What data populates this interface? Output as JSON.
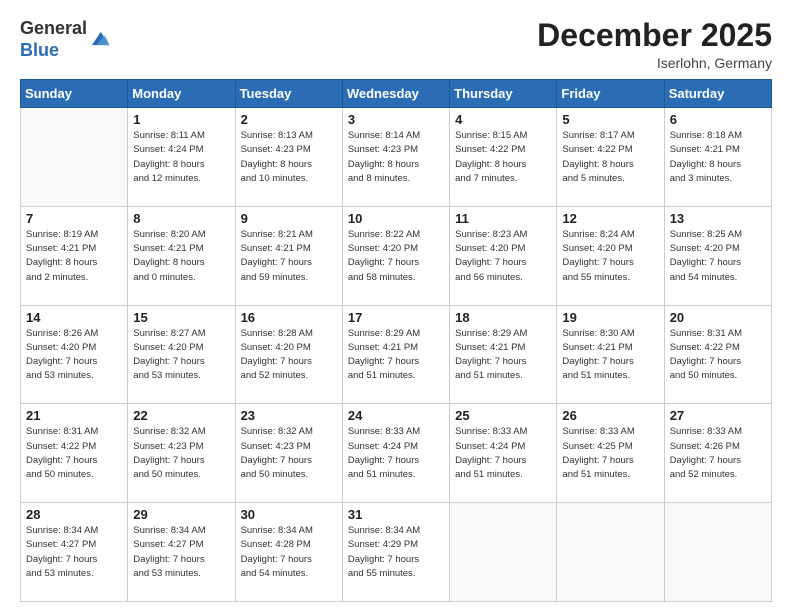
{
  "logo": {
    "line1": "General",
    "line2": "Blue"
  },
  "title": "December 2025",
  "subtitle": "Iserlohn, Germany",
  "days_header": [
    "Sunday",
    "Monday",
    "Tuesday",
    "Wednesday",
    "Thursday",
    "Friday",
    "Saturday"
  ],
  "weeks": [
    [
      {
        "day": "",
        "info": ""
      },
      {
        "day": "1",
        "info": "Sunrise: 8:11 AM\nSunset: 4:24 PM\nDaylight: 8 hours\nand 12 minutes."
      },
      {
        "day": "2",
        "info": "Sunrise: 8:13 AM\nSunset: 4:23 PM\nDaylight: 8 hours\nand 10 minutes."
      },
      {
        "day": "3",
        "info": "Sunrise: 8:14 AM\nSunset: 4:23 PM\nDaylight: 8 hours\nand 8 minutes."
      },
      {
        "day": "4",
        "info": "Sunrise: 8:15 AM\nSunset: 4:22 PM\nDaylight: 8 hours\nand 7 minutes."
      },
      {
        "day": "5",
        "info": "Sunrise: 8:17 AM\nSunset: 4:22 PM\nDaylight: 8 hours\nand 5 minutes."
      },
      {
        "day": "6",
        "info": "Sunrise: 8:18 AM\nSunset: 4:21 PM\nDaylight: 8 hours\nand 3 minutes."
      }
    ],
    [
      {
        "day": "7",
        "info": "Sunrise: 8:19 AM\nSunset: 4:21 PM\nDaylight: 8 hours\nand 2 minutes."
      },
      {
        "day": "8",
        "info": "Sunrise: 8:20 AM\nSunset: 4:21 PM\nDaylight: 8 hours\nand 0 minutes."
      },
      {
        "day": "9",
        "info": "Sunrise: 8:21 AM\nSunset: 4:21 PM\nDaylight: 7 hours\nand 59 minutes."
      },
      {
        "day": "10",
        "info": "Sunrise: 8:22 AM\nSunset: 4:20 PM\nDaylight: 7 hours\nand 58 minutes."
      },
      {
        "day": "11",
        "info": "Sunrise: 8:23 AM\nSunset: 4:20 PM\nDaylight: 7 hours\nand 56 minutes."
      },
      {
        "day": "12",
        "info": "Sunrise: 8:24 AM\nSunset: 4:20 PM\nDaylight: 7 hours\nand 55 minutes."
      },
      {
        "day": "13",
        "info": "Sunrise: 8:25 AM\nSunset: 4:20 PM\nDaylight: 7 hours\nand 54 minutes."
      }
    ],
    [
      {
        "day": "14",
        "info": "Sunrise: 8:26 AM\nSunset: 4:20 PM\nDaylight: 7 hours\nand 53 minutes."
      },
      {
        "day": "15",
        "info": "Sunrise: 8:27 AM\nSunset: 4:20 PM\nDaylight: 7 hours\nand 53 minutes."
      },
      {
        "day": "16",
        "info": "Sunrise: 8:28 AM\nSunset: 4:20 PM\nDaylight: 7 hours\nand 52 minutes."
      },
      {
        "day": "17",
        "info": "Sunrise: 8:29 AM\nSunset: 4:21 PM\nDaylight: 7 hours\nand 51 minutes."
      },
      {
        "day": "18",
        "info": "Sunrise: 8:29 AM\nSunset: 4:21 PM\nDaylight: 7 hours\nand 51 minutes."
      },
      {
        "day": "19",
        "info": "Sunrise: 8:30 AM\nSunset: 4:21 PM\nDaylight: 7 hours\nand 51 minutes."
      },
      {
        "day": "20",
        "info": "Sunrise: 8:31 AM\nSunset: 4:22 PM\nDaylight: 7 hours\nand 50 minutes."
      }
    ],
    [
      {
        "day": "21",
        "info": "Sunrise: 8:31 AM\nSunset: 4:22 PM\nDaylight: 7 hours\nand 50 minutes."
      },
      {
        "day": "22",
        "info": "Sunrise: 8:32 AM\nSunset: 4:23 PM\nDaylight: 7 hours\nand 50 minutes."
      },
      {
        "day": "23",
        "info": "Sunrise: 8:32 AM\nSunset: 4:23 PM\nDaylight: 7 hours\nand 50 minutes."
      },
      {
        "day": "24",
        "info": "Sunrise: 8:33 AM\nSunset: 4:24 PM\nDaylight: 7 hours\nand 51 minutes."
      },
      {
        "day": "25",
        "info": "Sunrise: 8:33 AM\nSunset: 4:24 PM\nDaylight: 7 hours\nand 51 minutes."
      },
      {
        "day": "26",
        "info": "Sunrise: 8:33 AM\nSunset: 4:25 PM\nDaylight: 7 hours\nand 51 minutes."
      },
      {
        "day": "27",
        "info": "Sunrise: 8:33 AM\nSunset: 4:26 PM\nDaylight: 7 hours\nand 52 minutes."
      }
    ],
    [
      {
        "day": "28",
        "info": "Sunrise: 8:34 AM\nSunset: 4:27 PM\nDaylight: 7 hours\nand 53 minutes."
      },
      {
        "day": "29",
        "info": "Sunrise: 8:34 AM\nSunset: 4:27 PM\nDaylight: 7 hours\nand 53 minutes."
      },
      {
        "day": "30",
        "info": "Sunrise: 8:34 AM\nSunset: 4:28 PM\nDaylight: 7 hours\nand 54 minutes."
      },
      {
        "day": "31",
        "info": "Sunrise: 8:34 AM\nSunset: 4:29 PM\nDaylight: 7 hours\nand 55 minutes."
      },
      {
        "day": "",
        "info": ""
      },
      {
        "day": "",
        "info": ""
      },
      {
        "day": "",
        "info": ""
      }
    ]
  ]
}
